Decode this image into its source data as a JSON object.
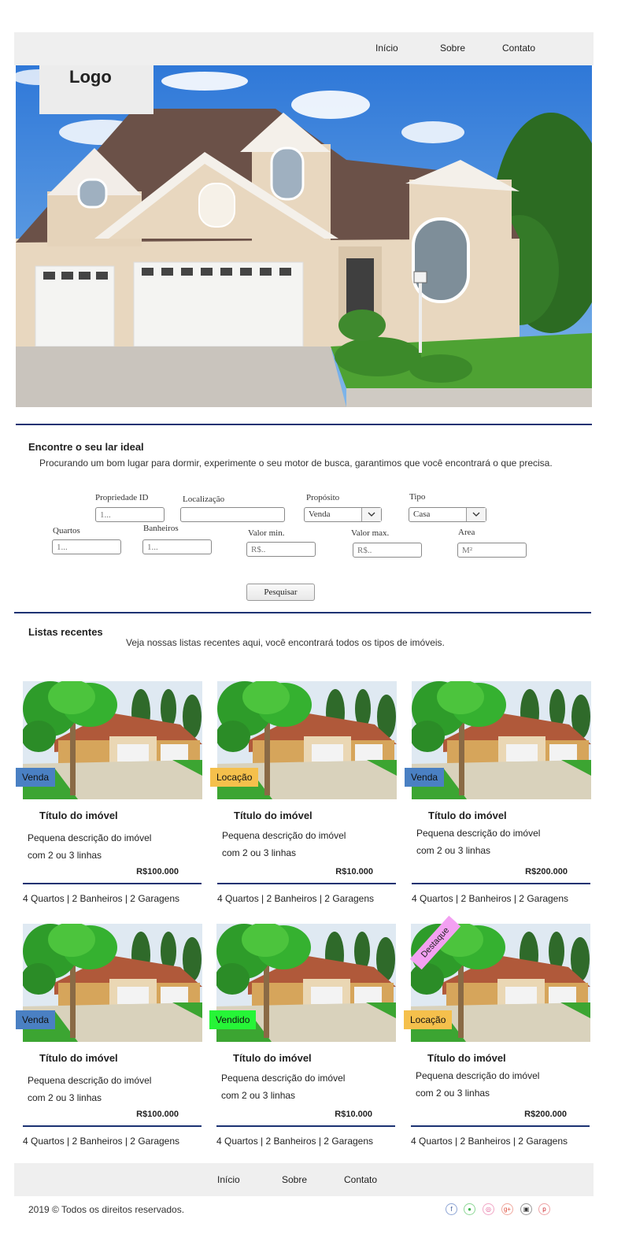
{
  "header": {
    "logo": "Logo",
    "nav": [
      "Início",
      "Sobre",
      "Contato"
    ]
  },
  "search": {
    "title": "Encontre o seu lar ideal",
    "subtitle": "Procurando um bom lugar para dormir, experimente o seu motor de busca, garantimos que você encontrará o que precisa.",
    "fields": {
      "propriedade_id": {
        "label": "Propriedade ID",
        "placeholder": "1..."
      },
      "localizacao": {
        "label": "Localização",
        "placeholder": ""
      },
      "proposito": {
        "label": "Propósito",
        "value": "Venda"
      },
      "tipo": {
        "label": "Tipo",
        "value": "Casa"
      },
      "quartos": {
        "label": "Quartos",
        "placeholder": "1..."
      },
      "banheiros": {
        "label": "Banheiros",
        "placeholder": "1..."
      },
      "valor_min": {
        "label": "Valor min.",
        "placeholder": "R$.."
      },
      "valor_max": {
        "label": "Valor max.",
        "placeholder": "R$.."
      },
      "area": {
        "label": "Area",
        "placeholder": "M²"
      }
    },
    "button": "Pesquisar"
  },
  "listings": {
    "title": "Listas recentes",
    "subtitle": "Veja nossas listas recentes aqui, você encontrará todos os tipos de imóveis.",
    "cards": [
      {
        "badge": "Venda",
        "badge_type": "venda",
        "title": "Título do imóvel",
        "desc_line1": "Pequena descrição do imóvel",
        "desc_line2": "com 2 ou 3 linhas",
        "price": "R$100.000",
        "features": "4 Quartos | 2 Banheiros | 2 Garagens"
      },
      {
        "badge": "Locação",
        "badge_type": "locacao",
        "title": "Título do imóvel",
        "desc_line1": "Pequena descrição do imóvel",
        "desc_line2": "com 2 ou 3 linhas",
        "price": "R$10.000",
        "features": "4 Quartos | 2 Banheiros | 2 Garagens"
      },
      {
        "badge": "Venda",
        "badge_type": "venda",
        "title": "Título do imóvel",
        "desc_line1": "Pequena descrição do imóvel",
        "desc_line2": "com 2 ou 3 linhas",
        "price": "R$200.000",
        "features": "4 Quartos | 2 Banheiros | 2 Garagens"
      },
      {
        "badge": "Venda",
        "badge_type": "venda",
        "title": "Título do imóvel",
        "desc_line1": "Pequena descrição do imóvel",
        "desc_line2": "com 2 ou 3 linhas",
        "price": "R$100.000",
        "features": "4 Quartos | 2 Banheiros | 2 Garagens"
      },
      {
        "badge": "Vendido",
        "badge_type": "vendido",
        "title": "Título do imóvel",
        "desc_line1": "Pequena descrição do imóvel",
        "desc_line2": "com 2 ou 3 linhas",
        "price": "R$10.000",
        "features": "4 Quartos | 2 Banheiros | 2 Garagens"
      },
      {
        "badge": "Locação",
        "badge_type": "locacao",
        "ribbon": "Destaque",
        "title": "Título do imóvel",
        "desc_line1": "Pequena descrição do imóvel",
        "desc_line2": "com 2 ou 3 linhas",
        "price": "R$200.000",
        "features": "4 Quartos | 2 Banheiros | 2 Garagens"
      }
    ]
  },
  "footer": {
    "nav": [
      "Início",
      "Sobre",
      "Contato"
    ],
    "copyright": "2019 © Todos os direitos reservados.",
    "social": [
      "facebook-icon",
      "evernote-icon",
      "dribbble-icon",
      "google-plus-icon",
      "instagram-icon",
      "pinterest-icon"
    ]
  },
  "colors": {
    "accent_rule": "#1c3272",
    "badge_venda": "#4a80c3",
    "badge_locacao": "#f5c04c",
    "badge_vendido": "#26f537",
    "ribbon": "#f3a0f2"
  }
}
